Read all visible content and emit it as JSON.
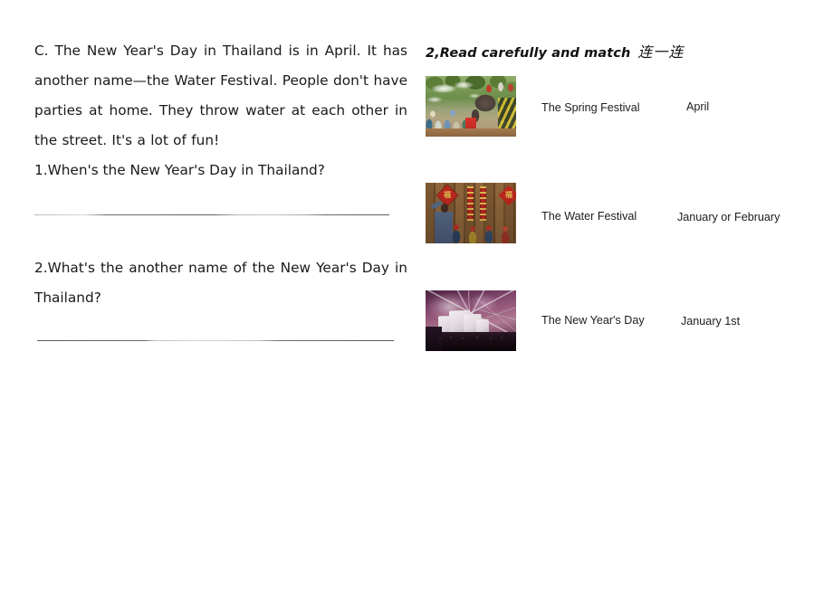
{
  "document": {
    "reading": {
      "passage_label": "C.",
      "passage_text": "C. The New Year's Day in Thailand is in April. It has another name—the Water Festival. People don't have parties at home. They throw water at each other in the street. It's a lot of fun!",
      "questions": [
        {
          "number": "1.",
          "text": "1.When's the New Year's Day in Thailand?"
        },
        {
          "number": "2.",
          "text": "2.What's the another name of the New Year's Day in Thailand?"
        }
      ]
    },
    "matching": {
      "section_number": "2,",
      "section_title_en": "2,Read carefully and match",
      "section_title_cn": "连一连",
      "rows": [
        {
          "photo_name": "water-festival-photo",
          "photo_alt": "Crowd spraying water with elephants at the Songkran Water Festival",
          "festival_label": "The Spring Festival",
          "date_label": "April"
        },
        {
          "photo_name": "spring-festival-photo",
          "photo_alt": "Person hanging red fu couplets on a wooden door with children watching",
          "festival_label": "The Water Festival",
          "date_label": "January or February"
        },
        {
          "photo_name": "new-years-fireworks-photo",
          "photo_alt": "Fireworks over the Sydney Opera House on New Year's Eve",
          "festival_label": "The New Year's Day",
          "date_label": "January 1st"
        }
      ],
      "fu_character": "福"
    }
  }
}
